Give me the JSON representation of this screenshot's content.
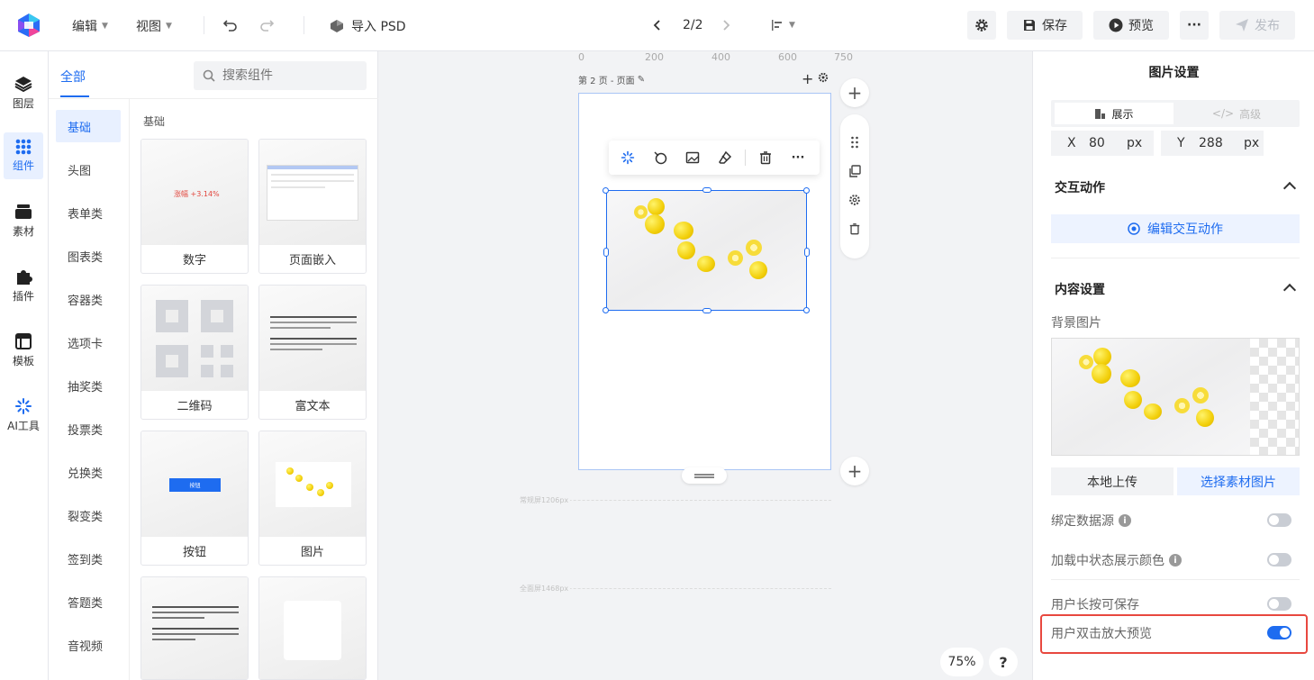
{
  "topbar": {
    "menu_edit": "编辑",
    "menu_view": "视图",
    "import_psd": "导入 PSD",
    "page_indicator": "2/2",
    "save": "保存",
    "preview": "预览",
    "more": "···",
    "publish": "发布"
  },
  "rail": {
    "items": [
      {
        "label": "图层",
        "icon": "layers-icon"
      },
      {
        "label": "组件",
        "icon": "grid-icon"
      },
      {
        "label": "素材",
        "icon": "material-icon"
      },
      {
        "label": "插件",
        "icon": "plugin-icon"
      },
      {
        "label": "模板",
        "icon": "template-icon"
      },
      {
        "label": "AI工具",
        "icon": "sparkle-icon"
      }
    ],
    "active": "组件"
  },
  "panel": {
    "tab_all": "全部",
    "search_placeholder": "搜索组件",
    "categories": [
      "基础",
      "头图",
      "表单类",
      "图表类",
      "容器类",
      "选项卡",
      "抽奖类",
      "投票类",
      "兑换类",
      "裂变类",
      "签到类",
      "答题类",
      "音视频"
    ],
    "section_title": "基础",
    "cards": [
      {
        "label": "数字",
        "thumb_text": "涨幅 +3.14%"
      },
      {
        "label": "页面嵌入"
      },
      {
        "label": "二维码"
      },
      {
        "label": "富文本"
      },
      {
        "label": "按钮",
        "thumb_text": "按钮"
      },
      {
        "label": "图片"
      },
      {
        "label": ""
      },
      {
        "label": ""
      }
    ]
  },
  "canvas": {
    "ruler": [
      "0",
      "200",
      "400",
      "600",
      "750"
    ],
    "page_title": "第 2 页 - 页面",
    "guide_normal": "常规屏1206px",
    "guide_full": "全面屏1468px",
    "zoom": "75%",
    "help": "?"
  },
  "rpanel": {
    "title": "图片设置",
    "tab_display": "展示",
    "tab_advanced": "高级",
    "x_label": "X",
    "x_value": "80",
    "y_label": "Y",
    "y_value": "288",
    "unit": "px",
    "interaction_title": "交互动作",
    "edit_interaction": "编辑交互动作",
    "content_title": "内容设置",
    "bg_image_label": "背景图片",
    "upload_local": "本地上传",
    "choose_material": "选择素材图片",
    "props": [
      {
        "label": "绑定数据源",
        "info": true,
        "on": false
      },
      {
        "label": "加载中状态展示颜色",
        "info": true,
        "on": false
      },
      {
        "label": "用户长按可保存",
        "info": false,
        "on": false
      },
      {
        "label": "用户双击放大预览",
        "info": false,
        "on": true
      }
    ]
  },
  "colors": {
    "accent": "#1e6cf0",
    "highlight": "#e8483f"
  }
}
